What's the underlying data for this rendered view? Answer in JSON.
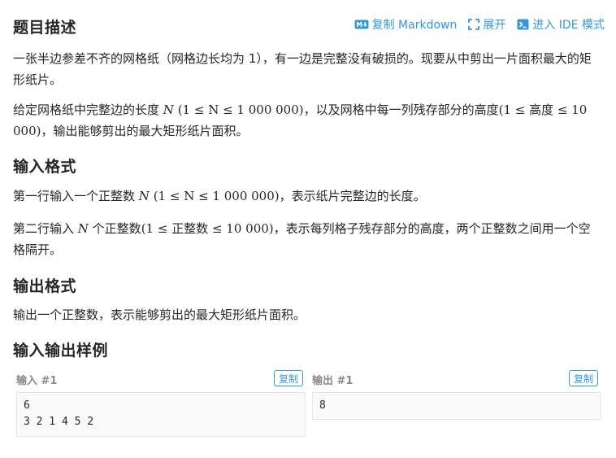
{
  "toolbar": {
    "copy_markdown": "复制 Markdown",
    "expand": "展开",
    "ide_mode": "进入 IDE 模式"
  },
  "description": {
    "title": "题目描述",
    "p1": "一张半边参差不齐的网格纸（网格边长均为 1），有一边是完整没有破损的。现要从中剪出一片面积最大的矩形纸片。",
    "p2_a": "给定网格纸中完整边的长度 ",
    "p2_var": "N",
    "p2_math": "(1 ≤ N ≤ 1 000 000)",
    "p2_b": "，以及网格中每一列残存部分的高度",
    "p2_math2": "(1 ≤ 高度 ≤ 10 000)",
    "p2_c": "，输出能够剪出的最大矩形纸片面积。"
  },
  "input_format": {
    "title": "输入格式",
    "p1_a": "第一行输入一个正整数 ",
    "p1_var": "N",
    "p1_math": "(1 ≤ N ≤ 1 000 000)",
    "p1_b": "，表示纸片完整边的长度。",
    "p2_a": "第二行输入 ",
    "p2_var": "N",
    "p2_b": " 个正整数",
    "p2_math": "(1 ≤ 正整数 ≤ 10 000)",
    "p2_c": "，表示每列格子残存部分的高度，两个正整数之间用一个空格隔开。"
  },
  "output_format": {
    "title": "输出格式",
    "p1": "输出一个正整数，表示能够剪出的最大矩形纸片面积。"
  },
  "samples": {
    "title": "输入输出样例",
    "input_label": "输入 #1",
    "output_label": "输出 #1",
    "copy_label": "复制",
    "input_text": "6\n3 2 1 4 5 2",
    "output_text": "8"
  },
  "colors": {
    "accent": "#3498db",
    "text": "#262626",
    "muted": "#8a8a8a",
    "code_bg": "#fafafa",
    "code_border": "#e6e6e6"
  },
  "icons": [
    "markdown-icon",
    "expand-icon",
    "terminal-icon"
  ]
}
